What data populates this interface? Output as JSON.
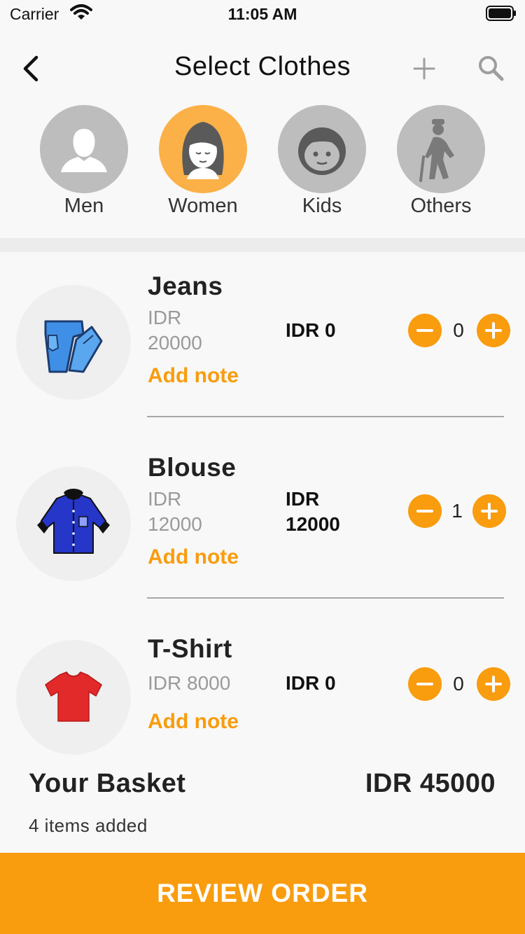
{
  "status_bar": {
    "carrier": "Carrier",
    "time": "11:05 AM"
  },
  "header": {
    "title": "Select Clothes"
  },
  "categories": [
    {
      "label": "Men",
      "icon": "man-icon",
      "active": false
    },
    {
      "label": "Women",
      "icon": "woman-icon",
      "active": true
    },
    {
      "label": "Kids",
      "icon": "kid-icon",
      "active": false
    },
    {
      "label": "Others",
      "icon": "elderly-icon",
      "active": false
    }
  ],
  "items": [
    {
      "name": "Jeans",
      "unit_price": "IDR 20000",
      "subtotal": "IDR 0",
      "qty": "0",
      "note": "Add note",
      "icon": "jeans-icon"
    },
    {
      "name": "Blouse",
      "unit_price": "IDR 12000",
      "subtotal": "IDR 12000",
      "qty": "1",
      "note": "Add note",
      "icon": "blouse-icon"
    },
    {
      "name": "T-Shirt",
      "unit_price": "IDR 8000",
      "subtotal": "IDR 0",
      "qty": "0",
      "note": "Add note",
      "icon": "tshirt-icon"
    }
  ],
  "basket": {
    "title": "Your Basket",
    "total": "IDR 45000",
    "count": "4 items added"
  },
  "review_button": {
    "label": "REVIEW ORDER"
  },
  "colors": {
    "accent": "#f99c0e",
    "active_category": "#fbb147",
    "inactive_category": "#bdbdbd"
  }
}
